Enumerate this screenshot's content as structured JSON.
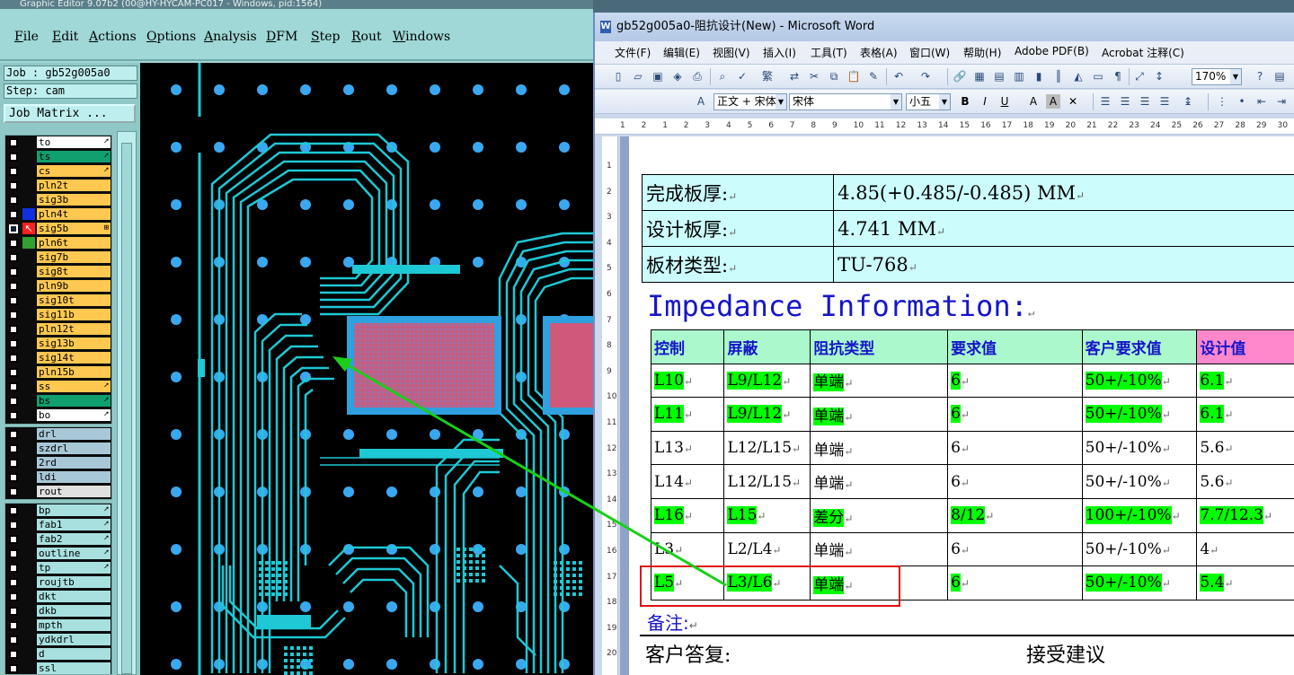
{
  "cam": {
    "title": "Graphic Editor 9.07b2 (00@HY-HYCAM-PC017 - Windows, pid:1564)",
    "menu": [
      "File",
      "Edit",
      "Actions",
      "Options",
      "Analysis",
      "DFM",
      "Step",
      "Rout",
      "Windows"
    ],
    "job": "Job : gb52g005a0",
    "step": "Step: cam",
    "job_matrix": "Job Matrix ...",
    "layers_board": [
      {
        "name": "to",
        "color": "#ffffff",
        "arrow": "➚"
      },
      {
        "name": "ts",
        "color": "#10a070",
        "arrow": "➚"
      },
      {
        "name": "cs",
        "color": "#ffc850",
        "arrow": "➚"
      },
      {
        "name": "pln2t",
        "color": "#ffc850"
      },
      {
        "name": "sig3b",
        "color": "#ffc850"
      },
      {
        "name": "pln4t",
        "color": "#ffc850",
        "swatch": "#1030e0"
      },
      {
        "name": "sig5b",
        "color": "#ffc850",
        "swatch": "#ff2020",
        "selected": true,
        "arrow": "⊞"
      },
      {
        "name": "pln6t",
        "color": "#ffc850",
        "swatch": "#30a030"
      },
      {
        "name": "sig7b",
        "color": "#ffc850"
      },
      {
        "name": "sig8t",
        "color": "#ffc850"
      },
      {
        "name": "pln9b",
        "color": "#ffc850"
      },
      {
        "name": "sig10t",
        "color": "#ffc850"
      },
      {
        "name": "sig11b",
        "color": "#ffc850"
      },
      {
        "name": "pln12t",
        "color": "#ffc850"
      },
      {
        "name": "sig13b",
        "color": "#ffc850"
      },
      {
        "name": "sig14t",
        "color": "#ffc850"
      },
      {
        "name": "pln15b",
        "color": "#ffc850"
      },
      {
        "name": "ss",
        "color": "#ffc850",
        "arrow": "➚"
      },
      {
        "name": "bs",
        "color": "#10a070",
        "arrow": "➚"
      },
      {
        "name": "bo",
        "color": "#ffffff",
        "arrow": "➚"
      }
    ],
    "layers_drill": [
      {
        "name": "drl",
        "color": "#a8c8d8"
      },
      {
        "name": "szdrl",
        "color": "#a8c8d8"
      },
      {
        "name": "2rd",
        "color": "#a8c8d8"
      },
      {
        "name": "ldi",
        "color": "#a8c8d8"
      },
      {
        "name": "rout",
        "color": "#e0e0e0"
      }
    ],
    "layers_misc": [
      {
        "name": "bp",
        "color": "#a8e0e0",
        "arrow": "➚"
      },
      {
        "name": "fab1",
        "color": "#a8e0e0",
        "arrow": "➚"
      },
      {
        "name": "fab2",
        "color": "#a8e0e0",
        "arrow": "➚"
      },
      {
        "name": "outline",
        "color": "#a8e0e0",
        "arrow": "➚"
      },
      {
        "name": "tp",
        "color": "#a8e0e0",
        "arrow": "➚"
      },
      {
        "name": "roujtb",
        "color": "#a8e0e0"
      },
      {
        "name": "dkt",
        "color": "#a8e0e0"
      },
      {
        "name": "dkb",
        "color": "#a8e0e0"
      },
      {
        "name": "mpth",
        "color": "#a8e0e0"
      },
      {
        "name": "ydkdrl",
        "color": "#a8e0e0"
      },
      {
        "name": "d",
        "color": "#a8e0e0"
      },
      {
        "name": "ssl",
        "color": "#a8e0e0"
      }
    ]
  },
  "word": {
    "title": "gb52g005a0-阻抗设计(New) - Microsoft Word",
    "menu": [
      "文件(F)",
      "编辑(E)",
      "视图(V)",
      "插入(I)",
      "工具(T)",
      "表格(A)",
      "窗口(W)",
      "帮助(H)",
      "Adobe PDF(B)",
      "Acrobat 注释(C)"
    ],
    "style_combo": "正文 + 宋体",
    "font_combo": "宋体",
    "size_combo": "小五",
    "zoom_combo": "170%",
    "ruler_numbers": [
      "1",
      "2",
      "1",
      "2",
      "3",
      "4",
      "5",
      "6",
      "7",
      "8",
      "9",
      "10",
      "11",
      "12",
      "13",
      "14",
      "15",
      "16",
      "17",
      "18",
      "19",
      "20",
      "21",
      "22",
      "23",
      "24",
      "25",
      "26",
      "27",
      "28",
      "29",
      "30"
    ],
    "vruler_numbers": [
      "1",
      "2",
      "3",
      "4",
      "5",
      "6",
      "7",
      "8",
      "9",
      "10",
      "11",
      "12",
      "13",
      "14",
      "15",
      "16",
      "17",
      "18",
      "19",
      "20",
      "21"
    ],
    "info_rows": [
      {
        "label": "完成板厚:",
        "value": "4.85(+0.485/-0.485) MM"
      },
      {
        "label": "设计板厚:",
        "value": "4.741 MM"
      },
      {
        "label": "板材类型:",
        "value": "TU-768"
      }
    ],
    "impedance_title": "Impedance Information:",
    "impedance_headers": [
      "控制",
      "屏蔽",
      "阻抗类型",
      "要求值",
      "客户要求值",
      "设计值"
    ],
    "impedance_rows": [
      {
        "cells": [
          "L10",
          "L9/L12",
          "单端",
          "6",
          "50+/-10%",
          "6.1"
        ],
        "hl": [
          1,
          1,
          1,
          1,
          1,
          1
        ]
      },
      {
        "cells": [
          "L11",
          "L9/L12",
          "单端",
          "6",
          "50+/-10%",
          "6.1"
        ],
        "hl": [
          1,
          1,
          1,
          1,
          1,
          1
        ]
      },
      {
        "cells": [
          "L13",
          "L12/L15",
          "单端",
          "6",
          "50+/-10%",
          "5.6"
        ],
        "hl": [
          0,
          0,
          0,
          0,
          0,
          0
        ]
      },
      {
        "cells": [
          "L14",
          "L12/L15",
          "单端",
          "6",
          "50+/-10%",
          "5.6"
        ],
        "hl": [
          0,
          0,
          0,
          0,
          0,
          0
        ]
      },
      {
        "cells": [
          "L16",
          "L15",
          "差分",
          "8/12",
          "100+/-10%",
          "7.7/12.3"
        ],
        "hl": [
          1,
          1,
          1,
          1,
          1,
          1
        ]
      },
      {
        "cells": [
          "L3",
          "L2/L4",
          "单端",
          "6",
          "50+/-10%",
          "4"
        ],
        "hl": [
          0,
          0,
          0,
          0,
          0,
          0
        ]
      },
      {
        "cells": [
          "L5",
          "L3/L6",
          "单端",
          "6",
          "50+/-10%",
          "5.4"
        ],
        "hl": [
          1,
          1,
          1,
          1,
          1,
          1
        ]
      }
    ],
    "note": "备注:",
    "reply_label": "客户答复:",
    "reply_value": "接受建议"
  },
  "colors": {
    "trace": "#1ec8d4",
    "pad": "#3aa8f0",
    "highlight": "#00ff00",
    "annotation_red": "#e01010",
    "arrow_green": "#18d018"
  }
}
